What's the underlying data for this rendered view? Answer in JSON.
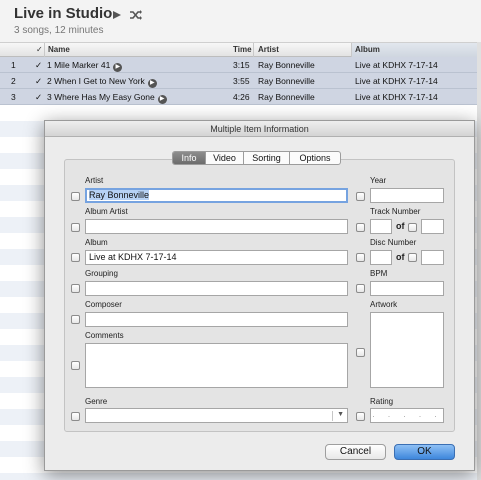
{
  "album": {
    "title": "Live in Studio",
    "subtitle": "3 songs, 12 minutes"
  },
  "columns": {
    "check": "✓",
    "name": "Name",
    "time": "Time",
    "artist": "Artist",
    "album": "Album"
  },
  "tracks": [
    {
      "index": "1",
      "check": "✓",
      "name": "1 Mile Marker 41",
      "time": "3:15",
      "artist": "Ray Bonneville",
      "album": "Live at KDHX 7-17-14"
    },
    {
      "index": "2",
      "check": "✓",
      "name": "2 When I Get to New York",
      "time": "3:55",
      "artist": "Ray Bonneville",
      "album": "Live at KDHX 7-17-14"
    },
    {
      "index": "3",
      "check": "✓",
      "name": "3 Where Has My Easy Gone",
      "time": "4:26",
      "artist": "Ray Bonneville",
      "album": "Live at KDHX 7-17-14"
    }
  ],
  "dialog": {
    "title": "Multiple Item Information",
    "tabs": [
      "Info",
      "Video",
      "Sorting",
      "Options"
    ],
    "active_tab": "Info",
    "labels": {
      "artist": "Artist",
      "album_artist": "Album Artist",
      "album": "Album",
      "grouping": "Grouping",
      "composer": "Composer",
      "comments": "Comments",
      "genre": "Genre",
      "year": "Year",
      "track_number": "Track Number",
      "disc_number": "Disc Number",
      "of": "of",
      "bpm": "BPM",
      "artwork": "Artwork",
      "rating": "Rating"
    },
    "values": {
      "artist": "Ray Bonneville",
      "album_artist": "",
      "album": "Live at KDHX 7-17-14",
      "grouping": "",
      "composer": "",
      "comments": "",
      "genre": "",
      "year": "",
      "track_number": "",
      "track_of": "",
      "disc_number": "",
      "disc_of": "",
      "bpm": ""
    },
    "rating_dots": "· · · · ·",
    "buttons": {
      "cancel": "Cancel",
      "ok": "OK"
    }
  },
  "colors": {
    "selected_row": "#cfd5e2",
    "focus_ring": "#76a3e0",
    "ok_button": "#3e87dc",
    "active_tab": "#7a7a7a"
  }
}
